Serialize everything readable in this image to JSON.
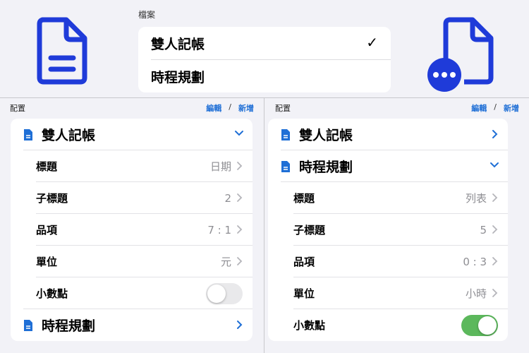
{
  "colors": {
    "accent": "#1f6fd6",
    "icon": "#1f3bd9",
    "toggle_on": "#5cb85c"
  },
  "file_picker": {
    "label": "檔案",
    "options": [
      {
        "label": "雙人記帳",
        "selected": true,
        "check": "✓"
      },
      {
        "label": "時程規劃",
        "selected": false
      }
    ]
  },
  "left_pane": {
    "title": "配置",
    "edit": "編輯",
    "slash": "/",
    "add": "新增",
    "group1": {
      "title": "雙人記帳",
      "expanded": true,
      "rows": [
        {
          "label": "標題",
          "value": "日期"
        },
        {
          "label": "子標題",
          "value": "2"
        },
        {
          "label": "品項",
          "value": "7 : 1"
        },
        {
          "label": "單位",
          "value": "元"
        }
      ],
      "decimal_label": "小數點",
      "decimal_on": false
    },
    "group2": {
      "title": "時程規劃",
      "expanded": false
    }
  },
  "right_pane": {
    "title": "配置",
    "edit": "編輯",
    "slash": "/",
    "add": "新增",
    "group1": {
      "title": "雙人記帳",
      "expanded": false
    },
    "group2": {
      "title": "時程規劃",
      "expanded": true,
      "rows": [
        {
          "label": "標題",
          "value": "列表"
        },
        {
          "label": "子標題",
          "value": "5"
        },
        {
          "label": "品項",
          "value": "0 : 3"
        },
        {
          "label": "單位",
          "value": "小時"
        }
      ],
      "decimal_label": "小數點",
      "decimal_on": true
    }
  }
}
